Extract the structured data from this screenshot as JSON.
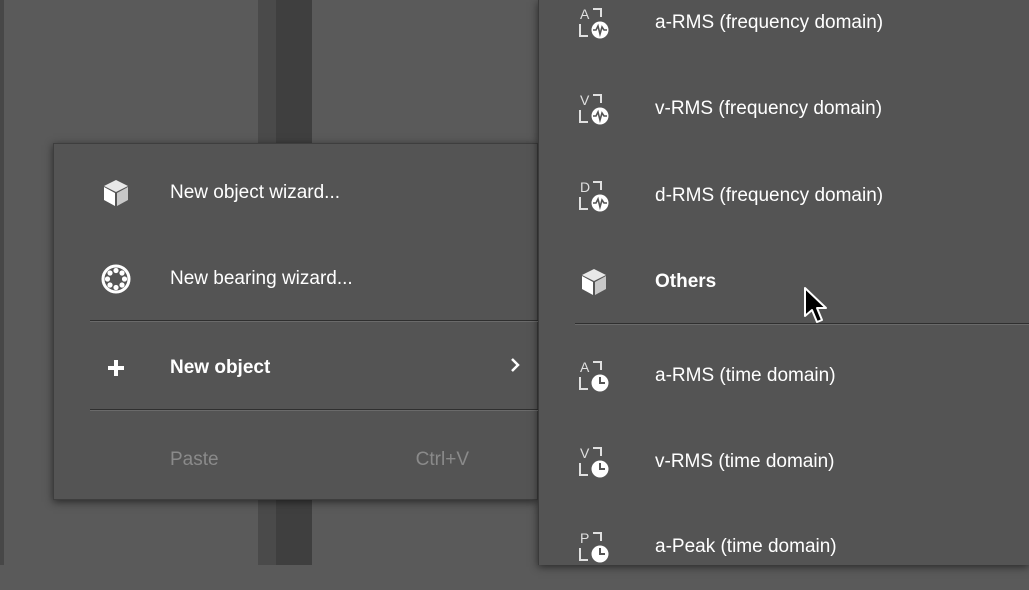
{
  "colors": {
    "menu_bg": "#545454",
    "page_bg": "#5a5a5a",
    "text": "#ffffff",
    "disabled": "#8a8a8a"
  },
  "context_menu": {
    "items": [
      {
        "label": "New object wizard...",
        "icon": "cube-icon"
      },
      {
        "label": "New bearing wizard...",
        "icon": "bearing-icon"
      },
      {
        "label": "New object",
        "icon": "plus-icon",
        "submenu_indicator": "›"
      },
      {
        "label": "Paste",
        "shortcut": "Ctrl+V",
        "disabled": true
      }
    ]
  },
  "submenu": {
    "items": [
      {
        "label": "a-RMS (frequency domain)",
        "icon": "a-frequency-icon",
        "letter": "A"
      },
      {
        "label": "v-RMS (frequency domain)",
        "icon": "v-frequency-icon",
        "letter": "V"
      },
      {
        "label": "d-RMS (frequency domain)",
        "icon": "d-frequency-icon",
        "letter": "D"
      },
      {
        "label": "Others",
        "icon": "cube-icon"
      },
      {
        "label": "a-RMS (time domain)",
        "icon": "a-time-icon",
        "letter": "A"
      },
      {
        "label": "v-RMS (time domain)",
        "icon": "v-time-icon",
        "letter": "V"
      },
      {
        "label": "a-Peak (time domain)",
        "icon": "p-time-icon",
        "letter": "P"
      }
    ]
  }
}
